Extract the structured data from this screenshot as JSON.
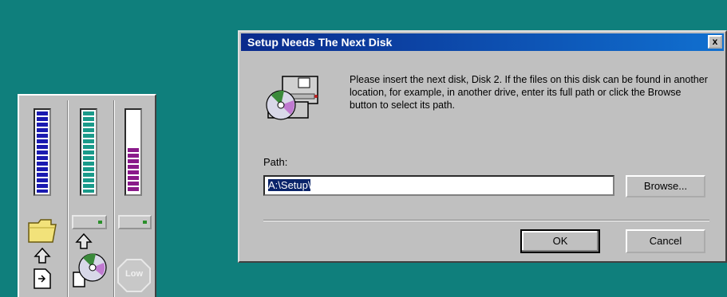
{
  "dialog": {
    "title": "Setup Needs The Next Disk",
    "close_label": "x",
    "message": "Please insert the next disk, Disk 2. If the files on this disk can be found in another location, for example, in another drive, enter its full path or click the Browse button to select its path.",
    "path_label": "Path:",
    "path_value": "A:\\Setup\\",
    "browse_label": "Browse...",
    "ok_label": "OK",
    "cancel_label": "Cancel",
    "icon": "disk-cd-drive-icon"
  },
  "panel": {
    "meters": [
      {
        "name": "source-meter",
        "level": 1.0,
        "color": "#1a1ab0"
      },
      {
        "name": "transfer-meter",
        "level": 1.0,
        "color": "#1a9a8a"
      },
      {
        "name": "disk-space-meter",
        "level": 0.55,
        "color": "#8a1a8a"
      }
    ],
    "low_label": "Low",
    "colors": {
      "desktop": "#0f7f7c",
      "face": "#c0c0c0"
    }
  }
}
